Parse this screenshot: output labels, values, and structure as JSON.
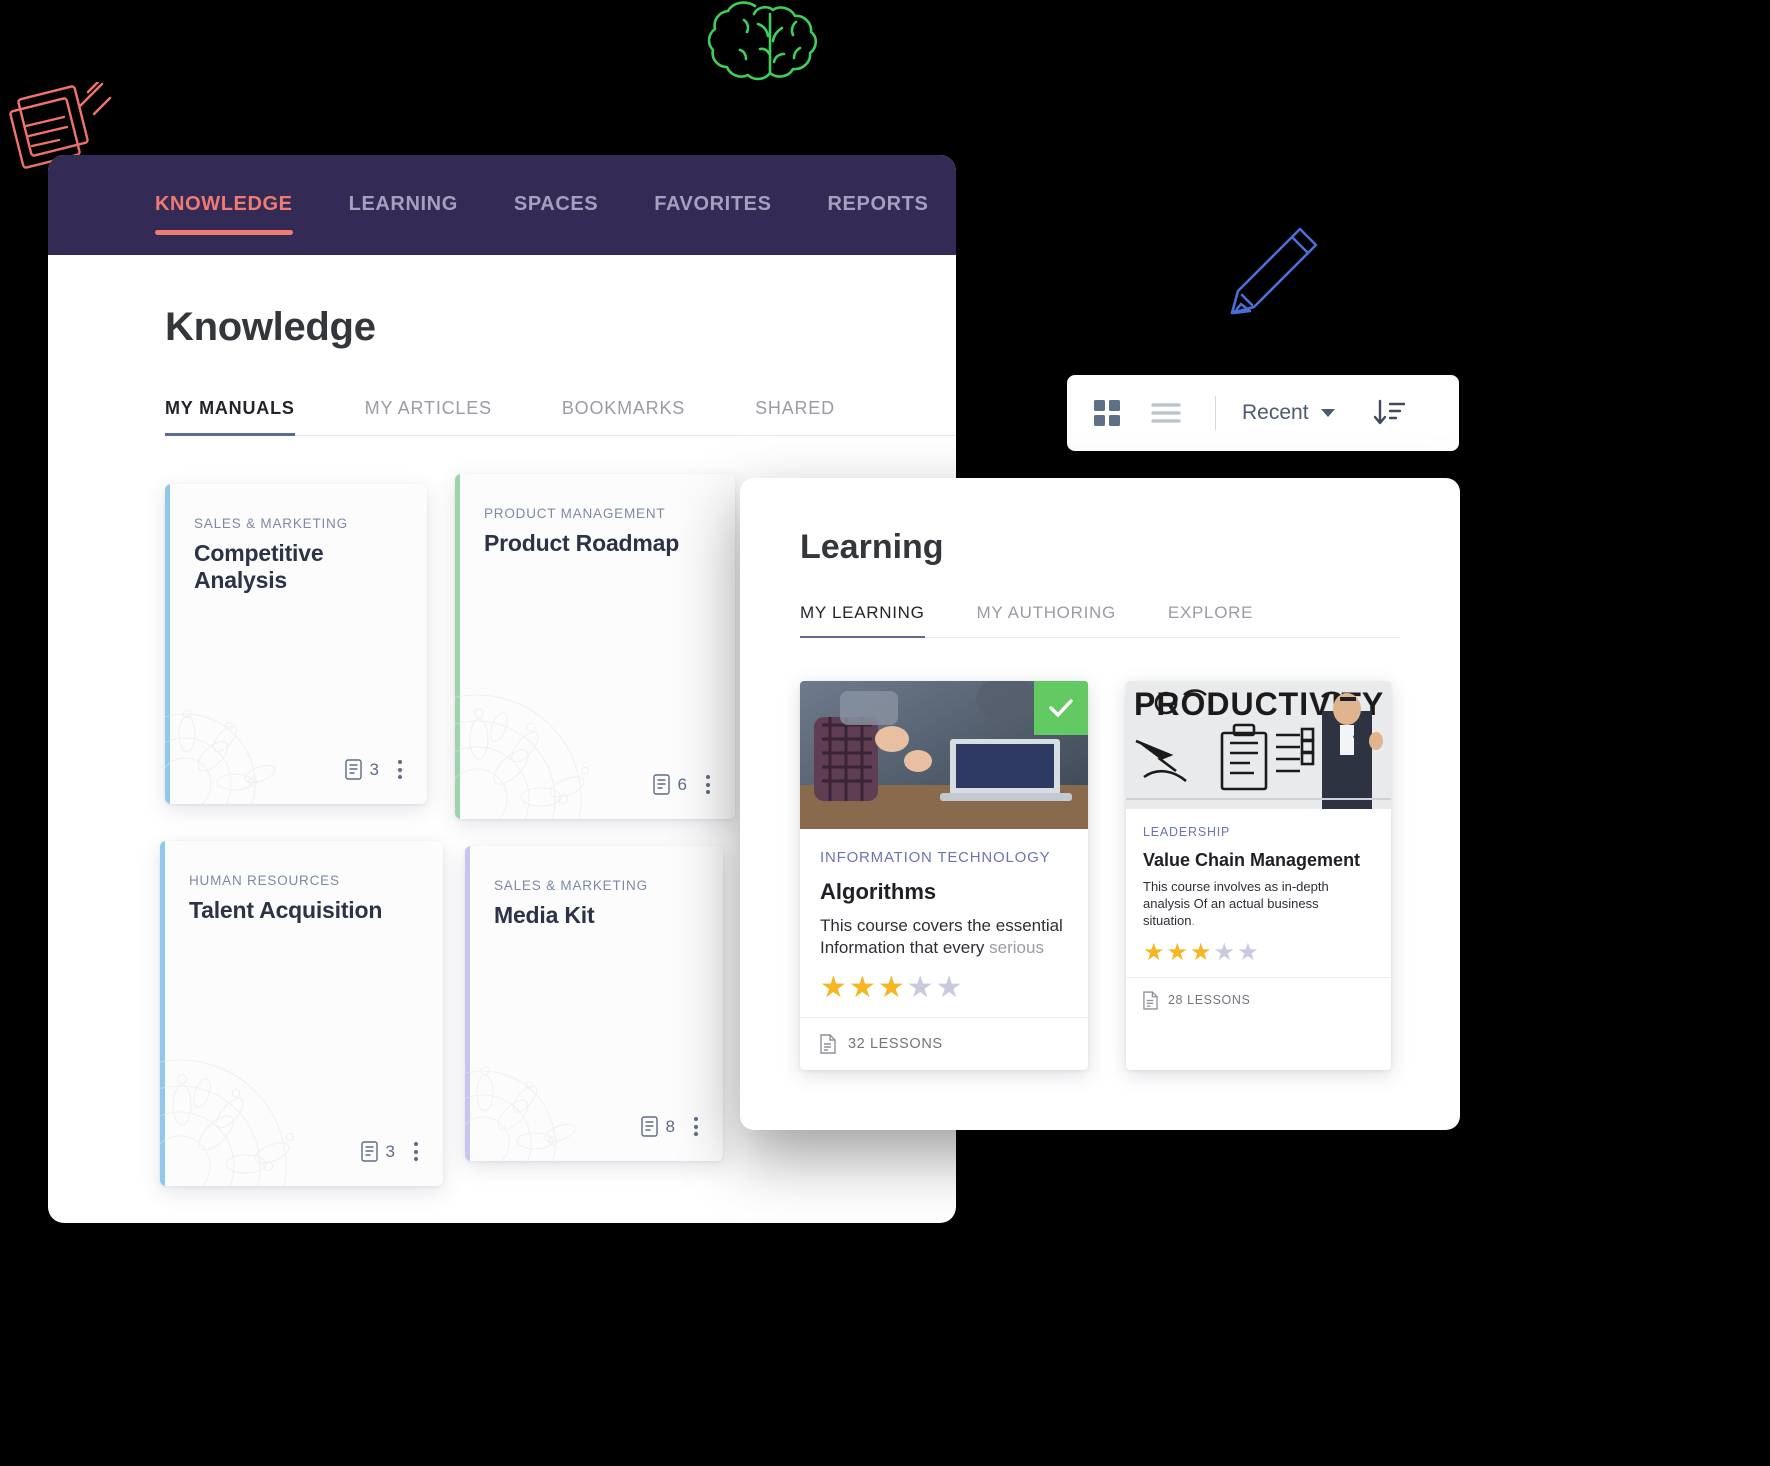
{
  "knowledge_window": {
    "topnav": [
      {
        "label": "KNOWLEDGE",
        "active": true
      },
      {
        "label": "LEARNING",
        "active": false
      },
      {
        "label": "SPACES",
        "active": false
      },
      {
        "label": "FAVORITES",
        "active": false
      },
      {
        "label": "REPORTS",
        "active": false
      }
    ],
    "page_title": "Knowledge",
    "tabs": [
      {
        "label": "MY MANUALS",
        "active": true
      },
      {
        "label": "MY ARTICLES",
        "active": false
      },
      {
        "label": "BOOKMARKS",
        "active": false
      },
      {
        "label": "SHARED",
        "active": false
      }
    ],
    "manuals": [
      {
        "category": "SALES & MARKETING",
        "title": "Competitive Analysis",
        "doc_count": "3",
        "spine_color": "#8fc8e8"
      },
      {
        "category": "PRODUCT MANAGEMENT",
        "title": "Product Roadmap",
        "doc_count": "6",
        "spine_color": "#9cd4ab"
      },
      {
        "category": "HUMAN RESOURCES",
        "title": "Talent Acquisition",
        "doc_count": "3",
        "spine_color": "#8fc8e8"
      },
      {
        "category": "SALES & MARKETING",
        "title": "Media Kit",
        "doc_count": "8",
        "spine_color": "#c3c7ee"
      }
    ]
  },
  "view_toolbar": {
    "grid_icon": "grid-view-icon",
    "list_icon": "list-view-icon",
    "sort_label": "Recent",
    "sort_direction_icon": "sort-descending-icon"
  },
  "learning_window": {
    "page_title": "Learning",
    "tabs": [
      {
        "label": "MY LEARNING",
        "active": true
      },
      {
        "label": "MY AUTHORING",
        "active": false
      },
      {
        "label": "EXPLORE",
        "active": false
      }
    ],
    "courses": [
      {
        "category": "INFORMATION TECHNOLOGY",
        "title": "Algorithms",
        "description_main": "This course covers the essential Information that every ",
        "description_dim": "serious",
        "rating": 3,
        "rating_max": 5,
        "lessons": "32 LESSONS",
        "completed": true,
        "completed_icon": "check-icon"
      },
      {
        "category": "LEADERSHIP",
        "title": "Value Chain Management",
        "description_main": "This course involves as in-depth analysis Of an actual business situation",
        "description_dim": ".",
        "rating": 3,
        "rating_max": 5,
        "lessons": "28 LESSONS",
        "completed": false,
        "completed_icon": ""
      }
    ]
  },
  "decorations": {
    "brain_icon": "brain-doodle-icon",
    "notes_icon": "notes-doodle-icon",
    "pencil_icon": "pencil-doodle-icon",
    "brain_color": "#3ecf5a",
    "notes_color": "#f4736d",
    "pencil_color": "#4a6fd4"
  },
  "colors": {
    "topbar": "#332a56",
    "accent": "#ef7b72",
    "tab_underline": "#5b6b92",
    "star_on": "#f5b623",
    "star_off": "#c9cade",
    "badge_green": "#63c963"
  }
}
